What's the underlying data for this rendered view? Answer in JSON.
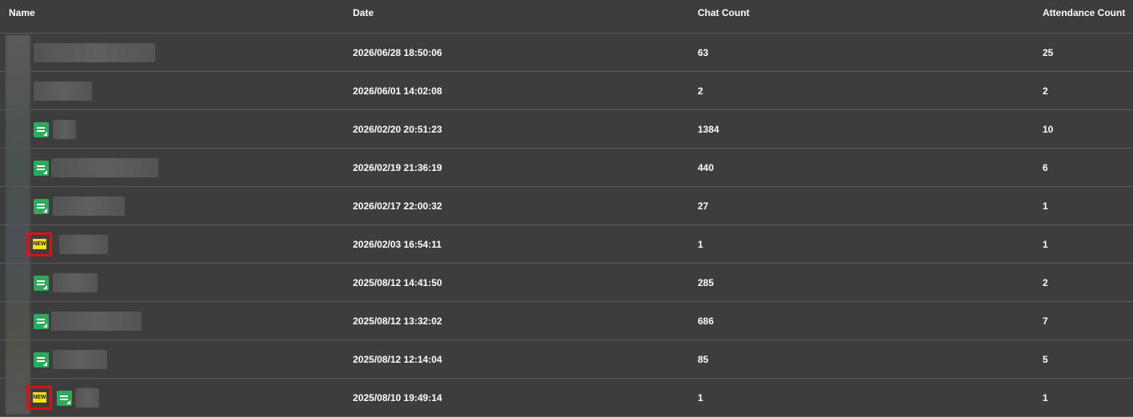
{
  "columns": {
    "name": "Name",
    "date": "Date",
    "chat_count": "Chat Count",
    "attendance_count": "Attendance Count"
  },
  "badge_new_label": "NEW",
  "colors": {
    "background": "#3d3d3d",
    "chat_icon": "#2faa5c",
    "new_badge": "#f7e01a",
    "highlight": "#e01010"
  },
  "rows": [
    {
      "date": "2026/06/28 18:50:06",
      "chat_count": "63",
      "attendance_count": "25",
      "chat_icon": false,
      "is_new": false
    },
    {
      "date": "2026/06/01 14:02:08",
      "chat_count": "2",
      "attendance_count": "2",
      "chat_icon": false,
      "is_new": false
    },
    {
      "date": "2026/02/20 20:51:23",
      "chat_count": "1384",
      "attendance_count": "10",
      "chat_icon": true,
      "is_new": false
    },
    {
      "date": "2026/02/19 21:36:19",
      "chat_count": "440",
      "attendance_count": "6",
      "chat_icon": true,
      "is_new": false
    },
    {
      "date": "2026/02/17 22:00:32",
      "chat_count": "27",
      "attendance_count": "1",
      "chat_icon": true,
      "is_new": false
    },
    {
      "date": "2026/02/03 16:54:11",
      "chat_count": "1",
      "attendance_count": "1",
      "chat_icon": false,
      "is_new": true
    },
    {
      "date": "2025/08/12 14:41:50",
      "chat_count": "285",
      "attendance_count": "2",
      "chat_icon": true,
      "is_new": false
    },
    {
      "date": "2025/08/12 13:32:02",
      "chat_count": "686",
      "attendance_count": "7",
      "chat_icon": true,
      "is_new": false
    },
    {
      "date": "2025/08/12 12:14:04",
      "chat_count": "85",
      "attendance_count": "5",
      "chat_icon": true,
      "is_new": false
    },
    {
      "date": "2025/08/10 19:49:14",
      "chat_count": "1",
      "attendance_count": "1",
      "chat_icon": true,
      "is_new": true
    }
  ]
}
